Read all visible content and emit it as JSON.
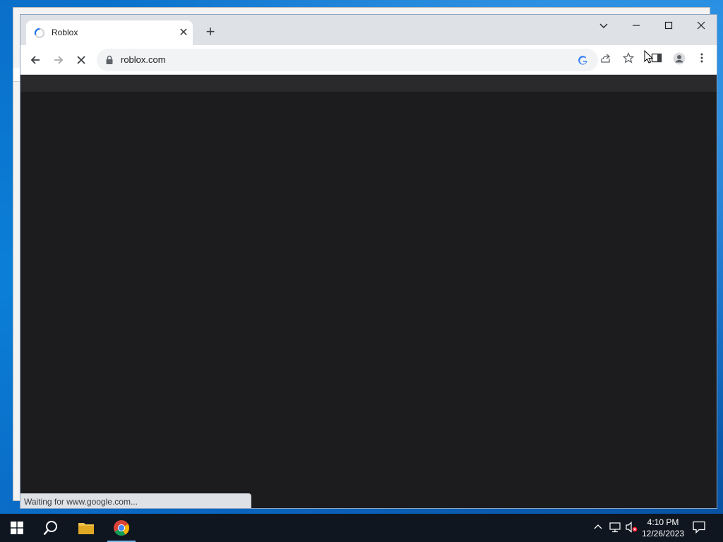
{
  "browser": {
    "tab": {
      "title": "Roblox",
      "close_icon": "close-icon"
    },
    "new_tab_icon": "plus-icon",
    "window_controls": [
      "chevron-down-icon",
      "minimize-icon",
      "maximize-icon",
      "close-icon"
    ],
    "toolbar": {
      "back_icon": "arrow-left-icon",
      "forward_icon": "arrow-right-icon",
      "stop_icon": "close-icon",
      "url": "roblox.com",
      "omnibox_icons": [
        "google-icon",
        "share-icon",
        "star-icon"
      ],
      "side_panel_icon": "side-panel-icon",
      "profile_icon": "profile-icon",
      "menu_icon": "more-vert-icon"
    },
    "status_text": "Waiting for www.google.com..."
  },
  "taskbar": {
    "items": [
      "windows-start-icon",
      "search-icon",
      "file-explorer-icon",
      "chrome-icon"
    ],
    "tray_icons": [
      "chevron-up-icon",
      "network-icon",
      "volume-muted-icon"
    ],
    "time": "4:10 PM",
    "date": "12/26/2023",
    "notification_icon": "notification-icon"
  },
  "colors": {
    "desktop": "#0b7fd8",
    "page_background": "#1c1c1e",
    "taskbar": "#0f1620",
    "tabstrip": "#dee1e6"
  }
}
